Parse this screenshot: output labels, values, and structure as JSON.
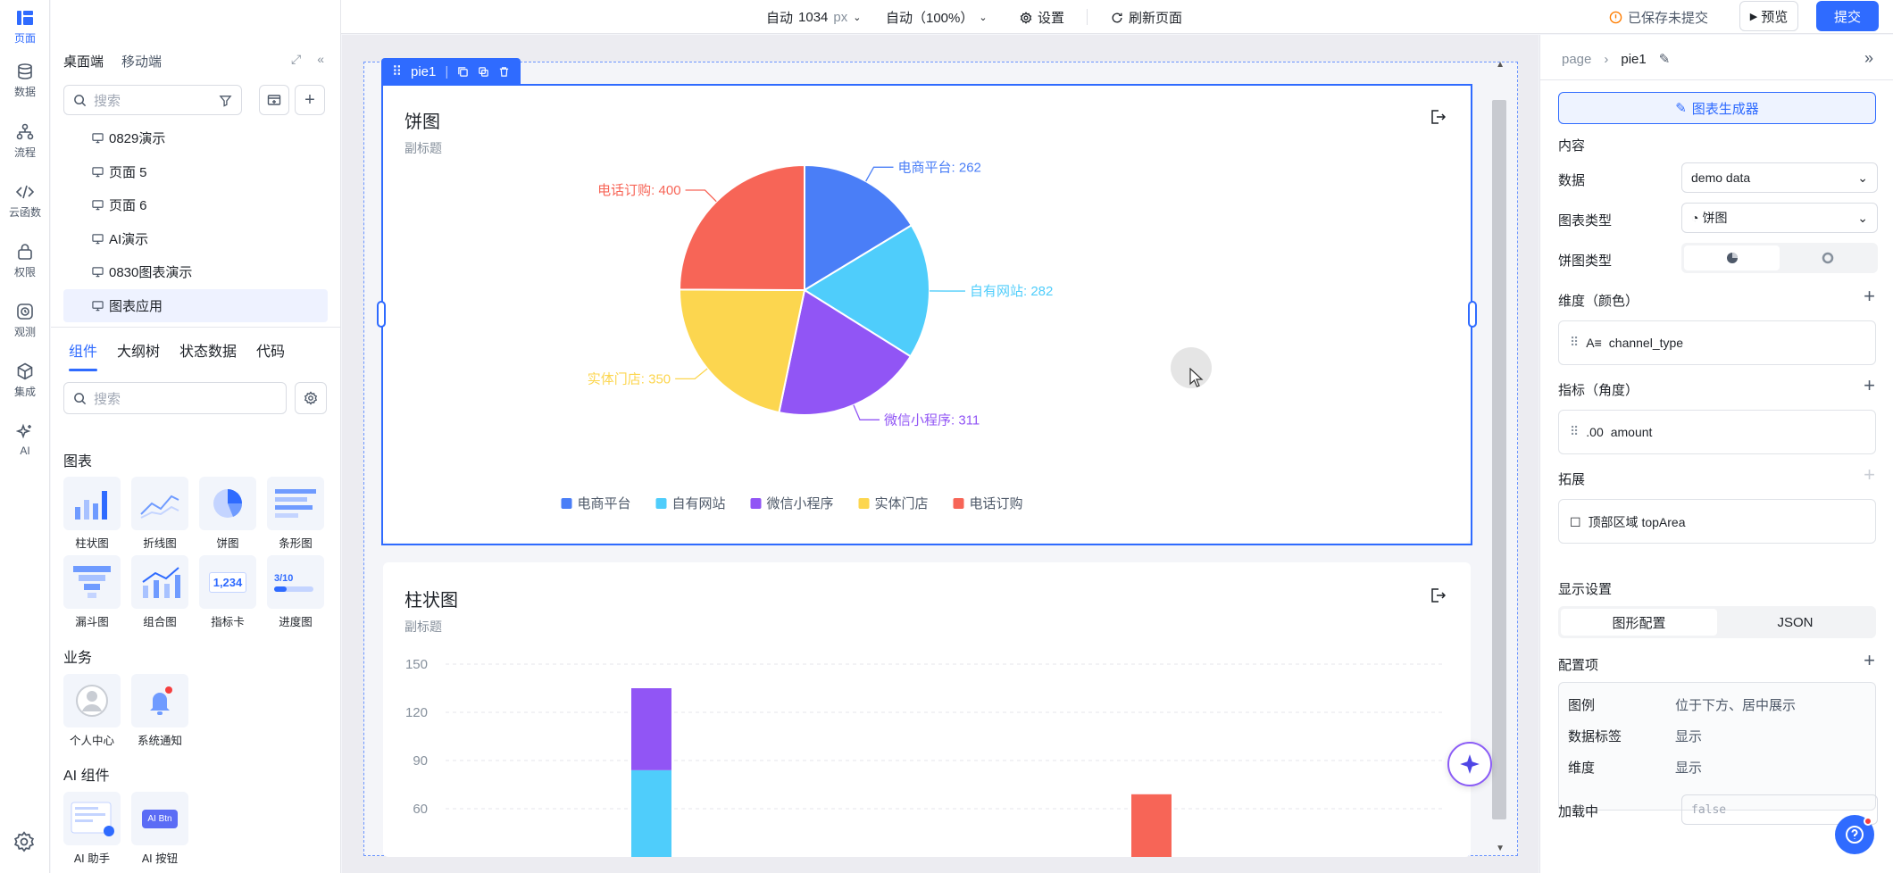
{
  "rail": {
    "items": [
      {
        "label": "页面",
        "icon": "layout-icon",
        "active": true
      },
      {
        "label": "数据",
        "icon": "database-icon"
      },
      {
        "label": "流程",
        "icon": "flow-icon"
      },
      {
        "label": "云函数",
        "icon": "code-icon"
      },
      {
        "label": "权限",
        "icon": "lock-icon"
      },
      {
        "label": "观测",
        "icon": "clock-icon"
      },
      {
        "label": "集成",
        "icon": "cube-icon"
      },
      {
        "label": "AI",
        "icon": "sparkle-icon"
      }
    ]
  },
  "left_panel": {
    "tabs": [
      "桌面端",
      "移动端"
    ],
    "search_placeholder": "搜索",
    "pages": [
      "0829演示",
      "页面 5",
      "页面 6",
      "AI演示",
      "0830图表演示",
      "图表应用"
    ],
    "selected_page": "图表应用",
    "component_tabs": [
      "组件",
      "大纲树",
      "状态数据",
      "代码"
    ],
    "component_search_placeholder": "搜索",
    "sections": {
      "charts_title": "图表",
      "charts": [
        "柱状图",
        "折线图",
        "饼图",
        "条形图",
        "漏斗图",
        "组合图",
        "指标卡",
        "进度图"
      ],
      "business_title": "业务",
      "business": [
        "个人中心",
        "系统通知"
      ],
      "ai_title": "AI 组件",
      "ai": [
        "AI 助手",
        "AI 按钮"
      ]
    },
    "metric_card_value": "1,234",
    "progress_value": "3/10",
    "ai_btn_text": "AI Btn"
  },
  "topbar": {
    "width_mode": "自动",
    "width_value": "1034",
    "width_unit": "px",
    "zoom": "自动（100%）",
    "settings": "设置",
    "refresh": "刷新页面",
    "save_status": "已保存未提交",
    "preview": "预览",
    "submit": "提交"
  },
  "canvas": {
    "selected_component": "pie1",
    "pie_card": {
      "title": "饼图",
      "subtitle": "副标题"
    },
    "bar_card": {
      "title": "柱状图",
      "subtitle": "副标题"
    }
  },
  "chart_data": [
    {
      "type": "pie",
      "title": "饼图",
      "subtitle": "副标题",
      "legend_position": "bottom-center",
      "slices": [
        {
          "name": "电商平台",
          "value": 262,
          "color": "#4a7ef7"
        },
        {
          "name": "自有网站",
          "value": 282,
          "color": "#4fcdfb"
        },
        {
          "name": "微信小程序",
          "value": 311,
          "color": "#9155f5"
        },
        {
          "name": "实体门店",
          "value": 350,
          "color": "#fcd64f"
        },
        {
          "name": "电话订购",
          "value": 400,
          "color": "#f76557"
        }
      ]
    },
    {
      "type": "bar",
      "title": "柱状图",
      "subtitle": "副标题",
      "y_ticks": [
        150,
        120,
        90,
        60
      ],
      "ylim": [
        0,
        150
      ],
      "bars": [
        {
          "segments": [
            {
              "value": 84,
              "color": "#4fcdfb"
            },
            {
              "value": 51,
              "color": "#9155f5"
            }
          ]
        },
        {
          "segments": [
            {
              "value": 69,
              "color": "#f76557"
            }
          ]
        }
      ]
    }
  ],
  "right_panel": {
    "breadcrumb_root": "page",
    "breadcrumb_current": "pie1",
    "generator_button": "图表生成器",
    "content_title": "内容",
    "data_label": "数据",
    "data_value": "demo data",
    "chart_type_label": "图表类型",
    "chart_type_value": "饼图",
    "pie_type_label": "饼图类型",
    "dimension_label": "维度（颜色）",
    "dimension_field": "channel_type",
    "metric_label": "指标（角度）",
    "metric_field": "amount",
    "metric_prefix": ".00",
    "extend_label": "拓展",
    "extend_item": "顶部区域 topArea",
    "display_title": "显示设置",
    "display_tabs": [
      "图形配置",
      "JSON"
    ],
    "config_label": "配置项",
    "config_rows": [
      {
        "key": "图例",
        "value": "位于下方、居中展示"
      },
      {
        "key": "数据标签",
        "value": "显示"
      },
      {
        "key": "维度",
        "value": "显示"
      }
    ],
    "loading_label": "加载中",
    "loading_value": "false"
  }
}
